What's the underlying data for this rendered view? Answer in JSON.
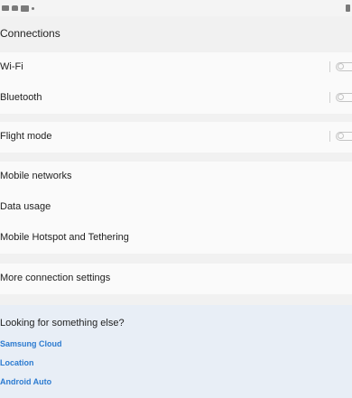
{
  "status_bar": {
    "icons": [
      "image-icon",
      "notification-icon",
      "message-icon",
      "dot-icon"
    ],
    "right_icon": "battery-icon"
  },
  "page": {
    "title": "Connections"
  },
  "rows": [
    {
      "label": "Wi-Fi",
      "toggle": "off"
    },
    {
      "label": "Bluetooth",
      "toggle": "off"
    },
    {
      "label": "Flight mode",
      "toggle": "off"
    },
    {
      "label": "Mobile networks"
    },
    {
      "label": "Data usage"
    },
    {
      "label": "Mobile Hotspot and Tethering"
    },
    {
      "label": "More connection settings"
    }
  ],
  "suggestions": {
    "title": "Looking for something else?",
    "links": [
      "Samsung Cloud",
      "Location",
      "Android Auto"
    ]
  },
  "colors": {
    "background": "#f1f1f1",
    "row_background": "#fafafa",
    "suggestion_background": "#e8eef6",
    "link": "#2c7bd0",
    "toggle_off": "#c4c4c4"
  }
}
